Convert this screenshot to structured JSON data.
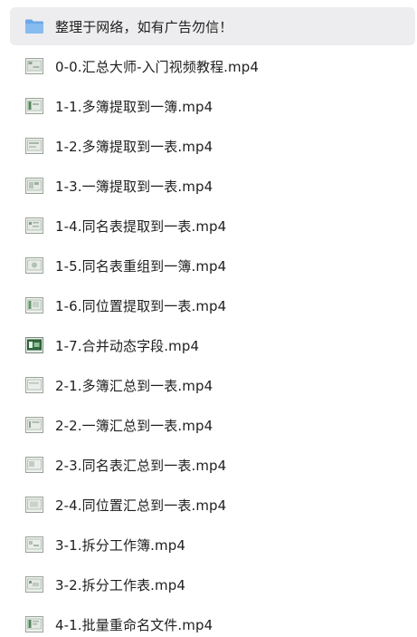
{
  "file_list": {
    "folder": {
      "name": "整理于网络，如有广告勿信！",
      "icon": "folder-icon",
      "color": "#6aa7e8"
    },
    "files": [
      {
        "name": "0-0.汇总大师-入门视频教程.mp4",
        "icon": "video-file-icon"
      },
      {
        "name": "1-1.多簿提取到一簿.mp4",
        "icon": "video-file-icon"
      },
      {
        "name": "1-2.多簿提取到一表.mp4",
        "icon": "video-file-icon"
      },
      {
        "name": "1-3.一簿提取到一表.mp4",
        "icon": "video-file-icon"
      },
      {
        "name": "1-4.同名表提取到一表.mp4",
        "icon": "video-file-icon"
      },
      {
        "name": "1-5.同名表重组到一簿.mp4",
        "icon": "video-file-icon"
      },
      {
        "name": "1-6.同位置提取到一表.mp4",
        "icon": "video-file-icon"
      },
      {
        "name": "1-7.合并动态字段.mp4",
        "icon": "video-file-icon"
      },
      {
        "name": "2-1.多簿汇总到一表.mp4",
        "icon": "video-file-icon"
      },
      {
        "name": "2-2.一簿汇总到一表.mp4",
        "icon": "video-file-icon"
      },
      {
        "name": "2-3.同名表汇总到一表.mp4",
        "icon": "video-file-icon"
      },
      {
        "name": "2-4.同位置汇总到一表.mp4",
        "icon": "video-file-icon"
      },
      {
        "name": "3-1.拆分工作簿.mp4",
        "icon": "video-file-icon"
      },
      {
        "name": "3-2.拆分工作表.mp4",
        "icon": "video-file-icon"
      },
      {
        "name": "4-1.批量重命名文件.mp4",
        "icon": "video-file-icon"
      }
    ]
  }
}
